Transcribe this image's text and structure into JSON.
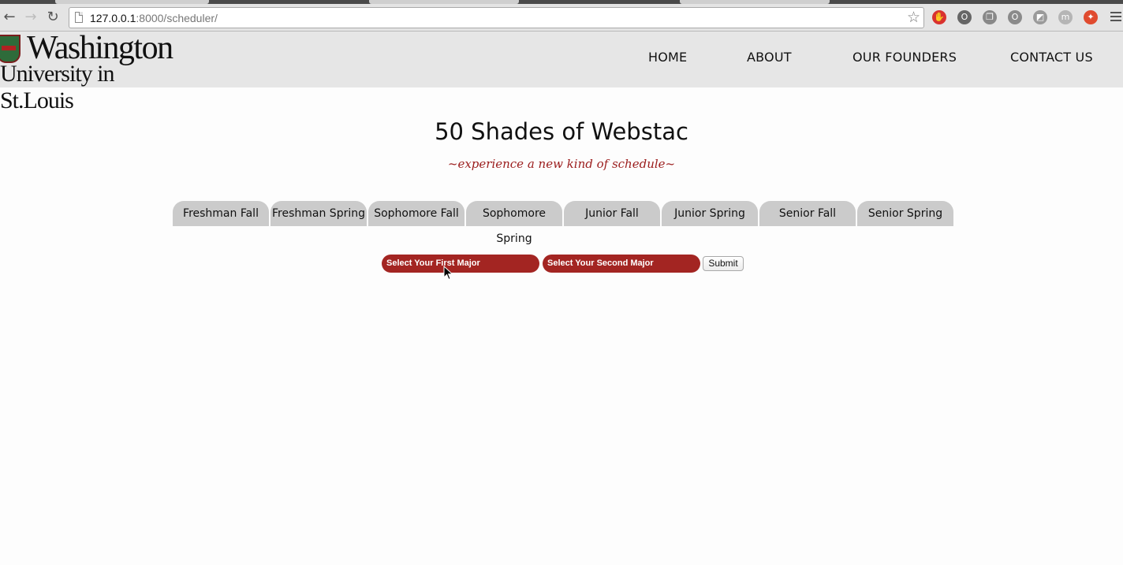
{
  "browser": {
    "url_host": "127.0.0.1",
    "url_rest": ":8000/scheduler/",
    "back_icon": "←",
    "forward_icon": "→",
    "reload_icon": "↻",
    "bookmark_icon": "☆",
    "extensions": [
      {
        "name": "adblock-icon",
        "glyph": "✋",
        "color": "#d9322f"
      },
      {
        "name": "ghostery-icon",
        "glyph": "O",
        "color": "#666666"
      },
      {
        "name": "copy-icon",
        "glyph": "❐",
        "color": "#888888"
      },
      {
        "name": "opera-icon",
        "glyph": "O",
        "color": "#8a8a8a"
      },
      {
        "name": "evernote-icon",
        "glyph": "◩",
        "color": "#9a9a9a"
      },
      {
        "name": "mail-icon",
        "glyph": "m",
        "color": "#b5b5b5"
      },
      {
        "name": "puzzle-icon",
        "glyph": "✦",
        "color": "#e04b2f"
      }
    ]
  },
  "site": {
    "logo_line1": "Washington",
    "logo_line2": "University in St.Louis",
    "nav": [
      "HOME",
      "ABOUT",
      "OUR FOUNDERS",
      "CONTACT US"
    ]
  },
  "main": {
    "title": "50 Shades of Webstac",
    "tagline": "~experience a new kind of schedule~",
    "tabs": [
      "Freshman Fall",
      "Freshman Spring",
      "Sophomore Fall",
      "Sophomore Spring",
      "Junior Fall",
      "Junior Spring",
      "Senior Fall",
      "Senior Spring"
    ],
    "first_major_placeholder": "Select Your First Major",
    "second_major_placeholder": "Select Your Second Major",
    "submit_label": "Submit"
  },
  "colors": {
    "accent_red": "#a32522",
    "tab_gray": "#cbcbcb",
    "header_gray": "#e6e6e6",
    "tagline_red": "#9b1c1c"
  }
}
